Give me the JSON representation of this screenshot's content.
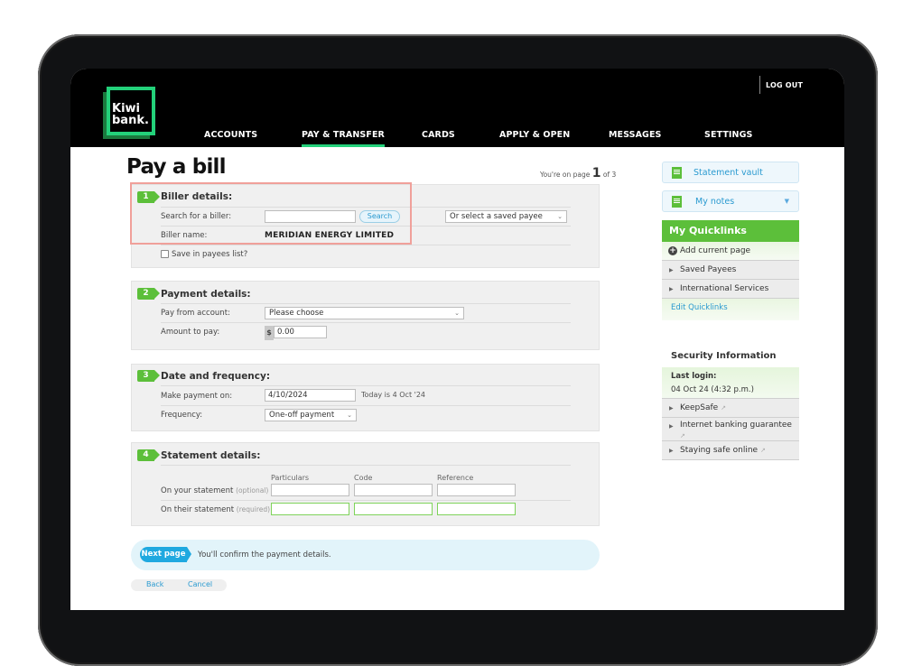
{
  "brand": {
    "logo_line1": "Kiwi",
    "logo_line2": "bank.",
    "accent": "#23d17a",
    "green": "#5cbf3a",
    "link": "#2a9ad0"
  },
  "header": {
    "logout": "LOG OUT",
    "nav": [
      {
        "label": "ACCOUNTS",
        "active": false
      },
      {
        "label": "PAY & TRANSFER",
        "active": true
      },
      {
        "label": "CARDS",
        "active": false
      },
      {
        "label": "APPLY & OPEN",
        "active": false
      },
      {
        "label": "MESSAGES",
        "active": false
      },
      {
        "label": "SETTINGS",
        "active": false
      }
    ]
  },
  "page": {
    "title": "Pay a bill",
    "pager_prefix": "You're on page",
    "pager_current": "1",
    "pager_suffix": "of 3"
  },
  "biller": {
    "step": "1",
    "title": "Biller details:",
    "search_label": "Search for a biller:",
    "search_value": "",
    "search_button": "Search",
    "saved_payee_select": "Or select a saved payee",
    "name_label": "Biller name:",
    "name_value": "MERIDIAN ENERGY LIMITED",
    "save_label": "Save in payees list?",
    "save_checked": false
  },
  "payment": {
    "step": "2",
    "title": "Payment details:",
    "from_label": "Pay from account:",
    "from_value": "Please choose",
    "amount_label": "Amount to pay:",
    "currency": "$",
    "amount_value": "0.00"
  },
  "date": {
    "step": "3",
    "title": "Date and frequency:",
    "date_label": "Make payment on:",
    "date_value": "4/10/2024",
    "today_text": "Today is 4 Oct '24",
    "freq_label": "Frequency:",
    "freq_value": "One-off payment"
  },
  "statement": {
    "step": "4",
    "title": "Statement details:",
    "columns": [
      "Particulars",
      "Code",
      "Reference"
    ],
    "your_label": "On your statement",
    "your_hint": "(optional)",
    "their_label": "On their statement",
    "their_hint": "(required)",
    "your_values": [
      "",
      "",
      ""
    ],
    "their_values": [
      "",
      "",
      ""
    ]
  },
  "footer": {
    "next_button": "Next page",
    "next_text": "You'll confirm the payment details.",
    "back": "Back",
    "cancel": "Cancel"
  },
  "sidebar": {
    "statement_vault": "Statement vault",
    "my_notes": "My notes",
    "quicklinks_title": "My Quicklinks",
    "add_current": "Add current page",
    "quicklinks": [
      "Saved Payees",
      "International Services"
    ],
    "edit_quicklinks": "Edit Quicklinks",
    "security_title": "Security Information",
    "last_login_label": "Last login:",
    "last_login_value": "04 Oct 24 (4:32 p.m.)",
    "security_links": [
      "KeepSafe",
      "Internet banking guarantee",
      "Staying safe online"
    ]
  }
}
